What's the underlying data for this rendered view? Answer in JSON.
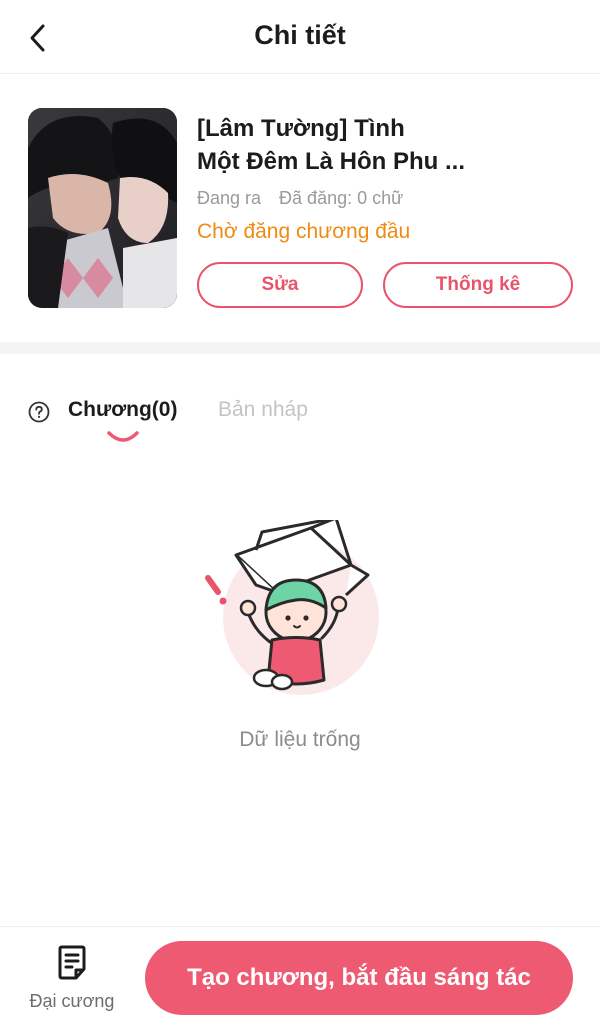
{
  "header": {
    "title": "Chi tiết",
    "back_icon": "chevron-left-icon"
  },
  "book": {
    "title_line1": "[Lâm Tường] Tình",
    "title_line2": "Một Đêm Là Hôn Phu ...",
    "status": "Đang ra",
    "word_count": "Đã đăng: 0 chữ",
    "pending_label": "Chờ đăng chương đầu",
    "edit_label": "Sửa",
    "stats_label": "Thống kê"
  },
  "tabs": {
    "help_icon": "question-circle-icon",
    "chapters_label": "Chương(0)",
    "drafts_label": "Bản nháp",
    "active": "chapters"
  },
  "empty_state": {
    "text": "Dữ liệu trống",
    "illustration": "character-holding-box-illustration"
  },
  "bottom_bar": {
    "outline_label": "Đại cương",
    "outline_icon": "document-list-icon",
    "create_label": "Tạo chương, bắt đầu sáng tác"
  },
  "colors": {
    "accent": "#ee5a72",
    "pending": "#ef8a12",
    "muted": "#9a9a9a"
  }
}
